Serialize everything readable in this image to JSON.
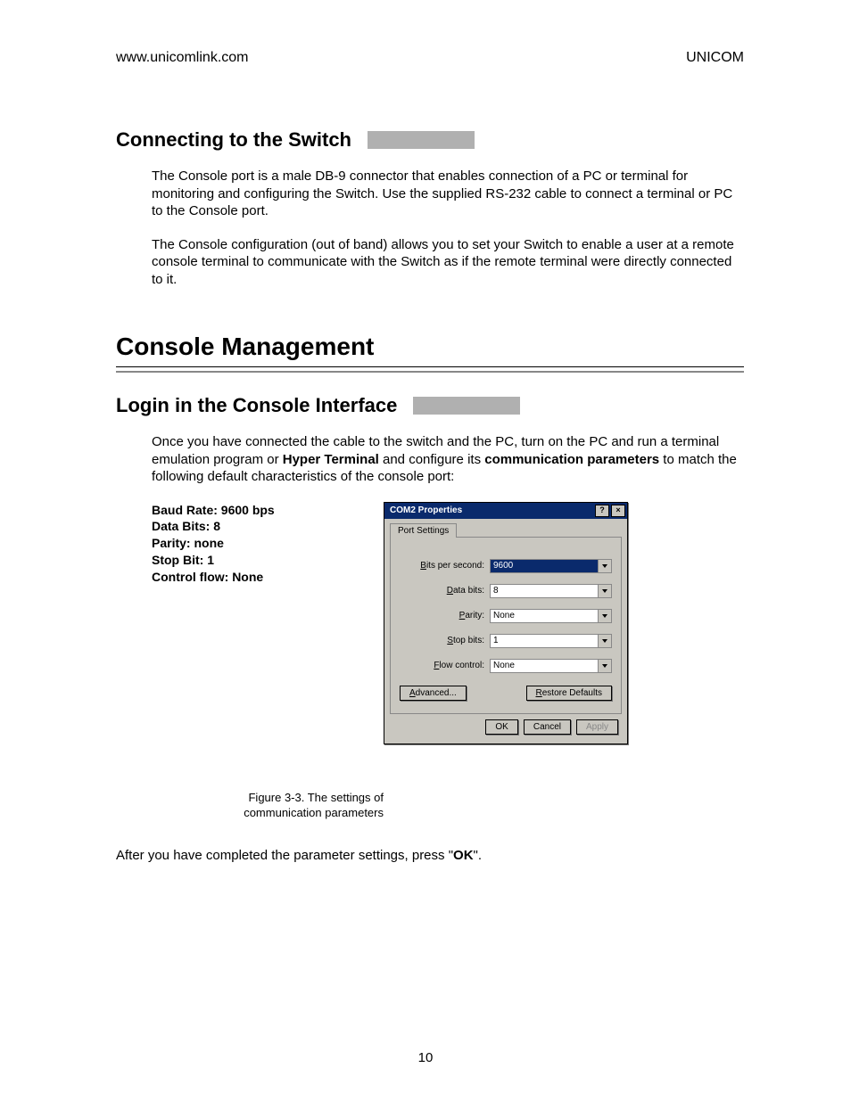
{
  "header": {
    "left": "www.unicomlink.com",
    "right": "UNICOM"
  },
  "section1": {
    "title": "Connecting to the Switch",
    "para1": "The Console port is a male DB-9 connector that enables connection of a PC or terminal for monitoring and configuring the Switch. Use the supplied RS-232 cable to connect a terminal or PC to the Console port.",
    "para2": "The Console configuration (out of band) allows you to set your Switch to enable a user at a remote console terminal to communicate with the Switch as if the remote terminal were directly connected to it."
  },
  "main_heading": "Console Management",
  "section2": {
    "title": "Login in the Console Interface",
    "para1_a": "Once you have connected the cable to the switch and the PC, turn on the PC and run a terminal emulation program or ",
    "para1_b": "Hyper Terminal",
    "para1_c": " and configure its ",
    "para1_d": "communication parameters",
    "para1_e": " to match the following default characteristics of the console port:"
  },
  "params": {
    "baud": "Baud Rate: 9600 bps",
    "data": "Data Bits: 8",
    "parity": "Parity: none",
    "stop": "Stop Bit: 1",
    "flow": "Control flow: None"
  },
  "caption": {
    "line1": "Figure 3-3. The settings of",
    "line2": "communication parameters"
  },
  "dialog": {
    "title": "COM2 Properties",
    "help_btn": "?",
    "close_btn": "×",
    "tab": "Port Settings",
    "fields": {
      "bps_label": "Bits per second:",
      "bps_value": "9600",
      "databits_label": "Data bits:",
      "databits_value": "8",
      "parity_label": "Parity:",
      "parity_value": "None",
      "stopbits_label": "Stop bits:",
      "stopbits_value": "1",
      "flow_label": "Flow control:",
      "flow_value": "None"
    },
    "advanced": "Advanced...",
    "restore": "Restore Defaults",
    "ok": "OK",
    "cancel": "Cancel",
    "apply": "Apply"
  },
  "after_text_a": "After you have completed the parameter settings, press \"",
  "after_text_b": "OK",
  "after_text_c": "\".",
  "page_number": "10"
}
